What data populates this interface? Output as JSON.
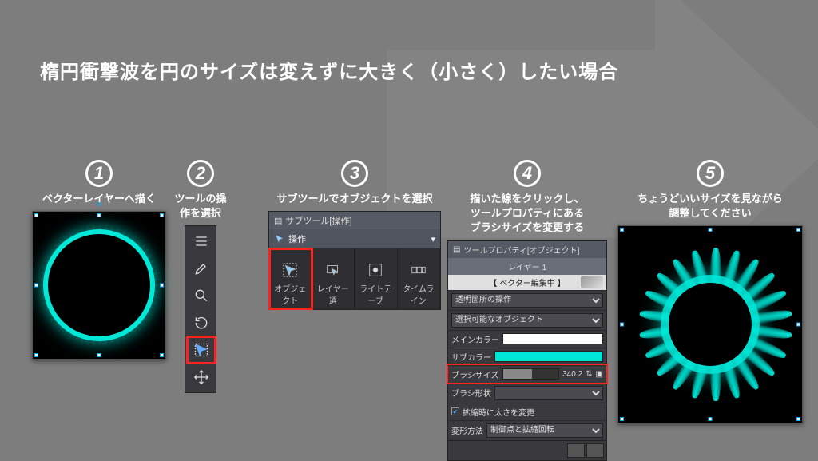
{
  "title": "楕円衝撃波を円のサイズは変えずに大きく（小さく）したい場合",
  "steps": {
    "n1": "1",
    "n2": "2",
    "n3": "3",
    "n4": "4",
    "n5": "5",
    "l1": "ベクターレイヤーへ描く",
    "l2": "ツールの操作を選択",
    "l3": "サブツールでオブジェクトを選択",
    "l4": "描いた線をクリックし、\nツールプロパティにある\nブラシサイズを変更する",
    "l5": "ちょうどいいサイズを見ながら\n調整してください"
  },
  "subtool": {
    "header": "サブツール[操作]",
    "titlebar": "操作",
    "tabs": [
      "オブジェクト",
      "レイヤー選",
      "ライトテーブ",
      "タイムライン"
    ]
  },
  "prop": {
    "header": "ツールプロパティ[オブジェクト]",
    "layer": "レイヤー 1",
    "vec": "【 ベクター編集中 】",
    "transp": "透明箇所の操作",
    "selectable": "選択可能なオブジェクト",
    "maincolor_l": "メインカラー",
    "subcolor_l": "サブカラー",
    "brushsize_l": "ブラシサイズ",
    "brushsize_v": "340.2",
    "brushshape_l": "ブラシ形状",
    "scalewidth": "拡縮時に太さを変更",
    "deform_l": "変形方法",
    "deform_v": "制御点と拡縮回転"
  },
  "colors": {
    "main": "#ffffff",
    "sub": "#00e6d6"
  }
}
